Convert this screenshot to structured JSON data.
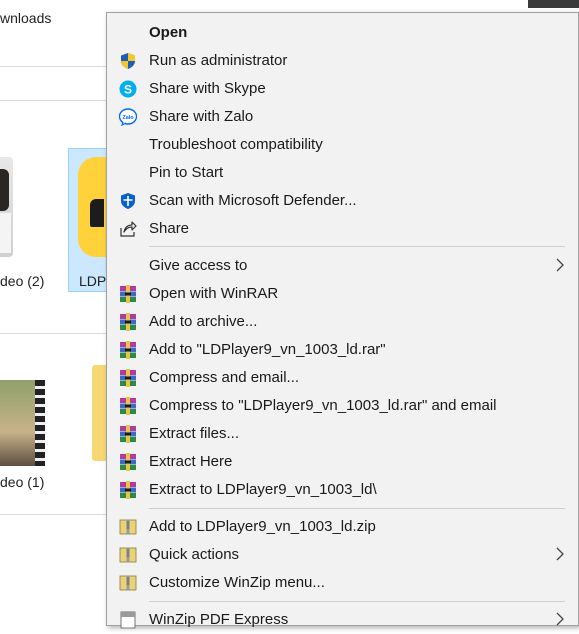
{
  "background": {
    "breadcrumb": "wnloads",
    "tiles": [
      {
        "label": "deo (2)"
      },
      {
        "label": "LDP"
      },
      {
        "label": "deo (1)"
      }
    ]
  },
  "menu": {
    "items": [
      {
        "label": "Open",
        "icon": "none",
        "bold": true
      },
      {
        "label": "Run as administrator",
        "icon": "uac-shield-icon"
      },
      {
        "label": "Share with Skype",
        "icon": "skype-icon"
      },
      {
        "label": "Share with Zalo",
        "icon": "zalo-icon"
      },
      {
        "label": "Troubleshoot compatibility",
        "icon": "none"
      },
      {
        "label": "Pin to Start",
        "icon": "none"
      },
      {
        "label": "Scan with Microsoft Defender...",
        "icon": "defender-icon"
      },
      {
        "label": "Share",
        "icon": "share-icon"
      },
      {
        "label": "Give access to",
        "icon": "none",
        "submenu": true
      },
      {
        "label": "Open with WinRAR",
        "icon": "winrar-icon"
      },
      {
        "label": "Add to archive...",
        "icon": "winrar-icon"
      },
      {
        "label": "Add to \"LDPlayer9_vn_1003_ld.rar\"",
        "icon": "winrar-icon"
      },
      {
        "label": "Compress and email...",
        "icon": "winrar-icon"
      },
      {
        "label": "Compress to \"LDPlayer9_vn_1003_ld.rar\" and email",
        "icon": "winrar-icon"
      },
      {
        "label": "Extract files...",
        "icon": "winrar-icon"
      },
      {
        "label": "Extract Here",
        "icon": "winrar-icon"
      },
      {
        "label": "Extract to LDPlayer9_vn_1003_ld\\",
        "icon": "winrar-icon"
      },
      {
        "label": "Add to LDPlayer9_vn_1003_ld.zip",
        "icon": "winzip-icon"
      },
      {
        "label": "Quick actions",
        "icon": "winzip-icon",
        "submenu": true
      },
      {
        "label": "Customize WinZip menu...",
        "icon": "winzip-icon"
      },
      {
        "label": "WinZip PDF Express",
        "icon": "winzip-pdf-icon",
        "submenu": true
      }
    ]
  },
  "colors": {
    "menu_bg": "#f2f2f2",
    "selection_bg": "#cce8ff",
    "shield_blue": "#1e5fb4",
    "skype_blue": "#00aff0",
    "winrar_purple": "#7a2a8f"
  }
}
